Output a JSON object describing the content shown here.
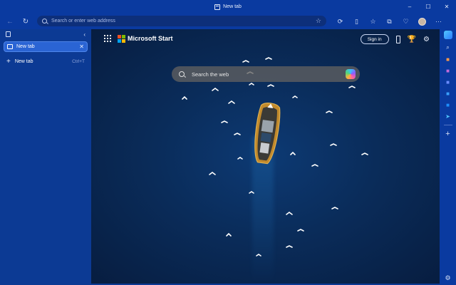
{
  "window": {
    "title": "New tab",
    "minimize": "–",
    "maximize": "☐",
    "close": "✕"
  },
  "toolbar": {
    "back": "←",
    "refresh": "↻",
    "address_placeholder": "Search or enter web address",
    "favorite_star": "☆",
    "more": "···",
    "icons": {
      "extensions": "⟳",
      "split_screen": "▯",
      "favorites": "☆",
      "collections": "⧉",
      "browser_essentials": "♡"
    }
  },
  "sidebar": {
    "collapse": "‹",
    "tabs": [
      {
        "label": "New tab",
        "close": "✕"
      }
    ],
    "new_tab": {
      "plus": "+",
      "label": "New tab",
      "shortcut": "Ctrl+T"
    }
  },
  "ntp": {
    "brand": "Microsoft Start",
    "sign_in": "Sign in",
    "search_placeholder": "Search the web",
    "logo_colors": [
      "#f25022",
      "#7fba00",
      "#00a4ef",
      "#ffb900"
    ],
    "icons": {
      "rewards": "🏆",
      "settings": "⚙"
    }
  },
  "rail": {
    "items": [
      {
        "name": "search",
        "glyph": "⌕",
        "color": "#d7e1f8"
      },
      {
        "name": "shopping",
        "glyph": "■",
        "color": "#ff9a4a"
      },
      {
        "name": "tools",
        "glyph": "■",
        "color": "#c36bd9"
      },
      {
        "name": "games",
        "glyph": "■",
        "color": "#6b8cff"
      },
      {
        "name": "office",
        "glyph": "■",
        "color": "#3aa0ff"
      },
      {
        "name": "outlook",
        "glyph": "■",
        "color": "#1e90ff"
      },
      {
        "name": "send",
        "glyph": "➤",
        "color": "#4fc3ff"
      }
    ],
    "add": "+",
    "settings": "⚙"
  }
}
